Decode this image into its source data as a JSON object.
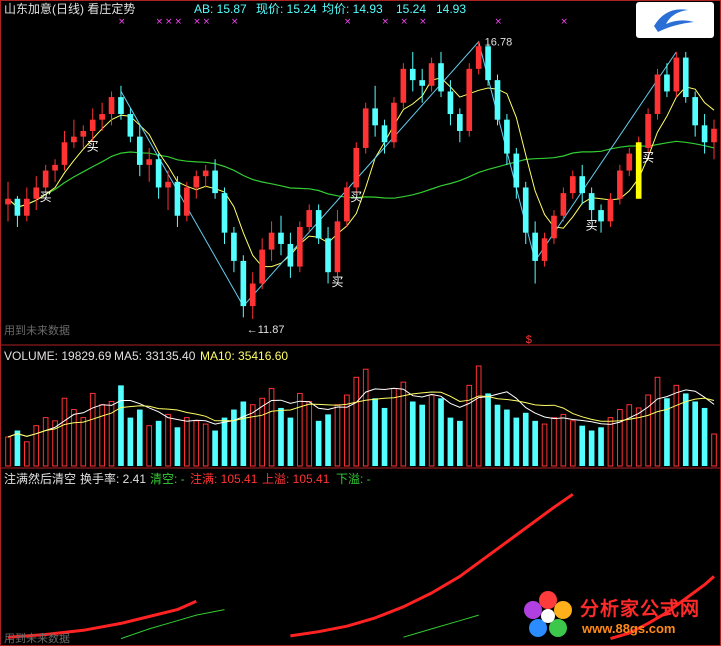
{
  "header": {
    "title": "山东加意(日线)",
    "indicator": "看庄定势",
    "ab_label": "AB: 15.87",
    "price_label": "现价: 15.24",
    "avg_label": "均价: 14.93",
    "extra_1": "15.24",
    "extra_2": "14.93"
  },
  "volume_header": {
    "volume": "VOLUME: 19829.69",
    "ma5": "MA5: 33135.40",
    "ma10": "MA10: 35416.60"
  },
  "indicator_header": {
    "name": "注满然后清空",
    "turnover": "换手率: 2.41",
    "clear": "清空: -",
    "full": "注满: 105.41",
    "overflow_up": "上溢: 105.41",
    "overflow_down": "下溢: -"
  },
  "watermark": "用到未来数据",
  "logo": {
    "name": "分析家公式网",
    "url": "www.88gs.com"
  },
  "colors": {
    "up": "#ff3333",
    "down": "#54ffff",
    "ma_short": "#ffffff",
    "ma_mid": "#ffff66",
    "ma_long": "#33cc33",
    "trend": "#66ccee",
    "marker": "#ff44ff",
    "buy": "#ffffff",
    "highlight": "#ffff00",
    "ind_red": "#ff2222",
    "ind_green": "#33cc33"
  },
  "chart_data": {
    "type": "candlestick",
    "annotations": {
      "high": "16.78",
      "low": "←11.87",
      "dollar": "$",
      "buy": "买"
    },
    "price_range": [
      11.5,
      17.2
    ],
    "candles": [
      [
        13.9,
        14.3,
        13.6,
        14.0
      ],
      [
        14.0,
        14.05,
        13.5,
        13.7
      ],
      [
        13.7,
        14.2,
        13.6,
        14.0
      ],
      [
        14.0,
        14.4,
        13.8,
        14.2
      ],
      [
        14.2,
        14.6,
        14.1,
        14.5
      ],
      [
        14.5,
        14.7,
        14.3,
        14.6
      ],
      [
        14.6,
        15.2,
        14.5,
        15.0
      ],
      [
        15.0,
        15.4,
        14.9,
        15.1
      ],
      [
        15.1,
        15.3,
        14.9,
        15.2
      ],
      [
        15.2,
        15.6,
        15.0,
        15.4
      ],
      [
        15.4,
        15.7,
        15.2,
        15.5
      ],
      [
        15.5,
        15.9,
        15.3,
        15.8
      ],
      [
        15.8,
        16.0,
        15.4,
        15.5
      ],
      [
        15.5,
        15.6,
        15.0,
        15.1
      ],
      [
        15.1,
        15.3,
        14.4,
        14.6
      ],
      [
        14.6,
        14.9,
        14.3,
        14.7
      ],
      [
        14.7,
        14.8,
        14.0,
        14.2
      ],
      [
        14.2,
        14.5,
        13.8,
        14.3
      ],
      [
        14.3,
        14.4,
        13.5,
        13.7
      ],
      [
        13.7,
        14.3,
        13.6,
        14.2
      ],
      [
        14.2,
        14.5,
        14.0,
        14.4
      ],
      [
        14.4,
        14.6,
        14.2,
        14.5
      ],
      [
        14.5,
        14.7,
        14.0,
        14.1
      ],
      [
        14.1,
        14.2,
        13.2,
        13.4
      ],
      [
        13.4,
        13.5,
        12.7,
        12.9
      ],
      [
        12.9,
        13.0,
        11.9,
        12.1
      ],
      [
        12.1,
        12.7,
        11.87,
        12.5
      ],
      [
        12.5,
        13.3,
        12.4,
        13.1
      ],
      [
        13.1,
        13.6,
        12.9,
        13.4
      ],
      [
        13.4,
        13.7,
        13.0,
        13.2
      ],
      [
        13.2,
        13.4,
        12.6,
        12.8
      ],
      [
        12.8,
        13.6,
        12.7,
        13.5
      ],
      [
        13.5,
        13.9,
        13.4,
        13.8
      ],
      [
        13.8,
        13.9,
        13.2,
        13.3
      ],
      [
        13.3,
        13.5,
        12.5,
        12.7
      ],
      [
        12.7,
        13.8,
        12.6,
        13.6
      ],
      [
        13.6,
        14.3,
        13.5,
        14.2
      ],
      [
        14.2,
        15.0,
        14.1,
        14.9
      ],
      [
        14.9,
        15.7,
        14.8,
        15.6
      ],
      [
        15.6,
        16.0,
        15.1,
        15.3
      ],
      [
        15.3,
        15.4,
        14.8,
        15.0
      ],
      [
        15.0,
        15.8,
        14.9,
        15.7
      ],
      [
        15.7,
        16.4,
        15.6,
        16.3
      ],
      [
        16.3,
        16.6,
        15.9,
        16.1
      ],
      [
        16.1,
        16.3,
        15.7,
        16.0
      ],
      [
        16.0,
        16.5,
        15.9,
        16.4
      ],
      [
        16.4,
        16.6,
        15.8,
        15.9
      ],
      [
        15.9,
        16.1,
        15.3,
        15.5
      ],
      [
        15.5,
        15.6,
        15.0,
        15.2
      ],
      [
        15.2,
        16.4,
        15.1,
        16.3
      ],
      [
        16.3,
        16.78,
        16.2,
        16.7
      ],
      [
        16.7,
        16.75,
        16.0,
        16.1
      ],
      [
        16.1,
        16.2,
        15.3,
        15.4
      ],
      [
        15.4,
        15.5,
        14.6,
        14.8
      ],
      [
        14.8,
        14.9,
        14.0,
        14.2
      ],
      [
        14.2,
        14.3,
        13.2,
        13.4
      ],
      [
        13.4,
        13.6,
        12.5,
        12.9
      ],
      [
        12.9,
        13.4,
        12.8,
        13.3
      ],
      [
        13.3,
        13.8,
        13.2,
        13.7
      ],
      [
        13.7,
        14.2,
        13.6,
        14.1
      ],
      [
        14.1,
        14.5,
        14.0,
        14.4
      ],
      [
        14.4,
        14.6,
        13.9,
        14.1
      ],
      [
        14.1,
        14.2,
        13.6,
        13.8
      ],
      [
        13.8,
        13.9,
        13.4,
        13.6
      ],
      [
        13.6,
        14.1,
        13.5,
        14.0
      ],
      [
        14.0,
        14.6,
        13.9,
        14.5
      ],
      [
        14.5,
        14.9,
        14.4,
        14.8
      ],
      [
        14.8,
        15.1,
        14.6,
        14.9
      ],
      [
        14.9,
        15.6,
        14.8,
        15.5
      ],
      [
        15.5,
        16.3,
        15.4,
        16.2
      ],
      [
        16.2,
        16.4,
        15.8,
        15.9
      ],
      [
        15.9,
        16.6,
        15.8,
        16.5
      ],
      [
        16.5,
        16.6,
        15.7,
        15.8
      ],
      [
        15.8,
        15.9,
        15.1,
        15.3
      ],
      [
        15.3,
        15.5,
        14.8,
        15.0
      ],
      [
        15.0,
        15.4,
        14.7,
        15.24
      ]
    ],
    "volume_range": [
      0,
      62000
    ],
    "volumes": [
      18000,
      22000,
      15000,
      25000,
      30000,
      28000,
      42000,
      35000,
      30000,
      45000,
      38000,
      40000,
      50000,
      30000,
      35000,
      25000,
      28000,
      32000,
      24000,
      30000,
      28000,
      26000,
      22000,
      30000,
      35000,
      40000,
      38000,
      42000,
      48000,
      36000,
      30000,
      45000,
      40000,
      28000,
      32000,
      38000,
      44000,
      55000,
      60000,
      42000,
      36000,
      48000,
      52000,
      40000,
      38000,
      44000,
      42000,
      30000,
      28000,
      50000,
      62000,
      45000,
      38000,
      35000,
      30000,
      33000,
      28000,
      26000,
      30000,
      32000,
      28000,
      25000,
      22000,
      24000,
      30000,
      35000,
      38000,
      36000,
      44000,
      55000,
      42000,
      50000,
      45000,
      40000,
      36000,
      19830
    ],
    "indicator_range": [
      0,
      110
    ],
    "indicator_red_segments": [
      [
        [
          0,
          2
        ],
        [
          4,
          4
        ],
        [
          8,
          7
        ],
        [
          12,
          12
        ],
        [
          15,
          17
        ],
        [
          18,
          22
        ],
        [
          20,
          28
        ]
      ],
      [
        [
          30,
          3
        ],
        [
          33,
          6
        ],
        [
          36,
          10
        ],
        [
          39,
          16
        ],
        [
          42,
          24
        ],
        [
          45,
          34
        ],
        [
          48,
          46
        ],
        [
          50,
          56
        ],
        [
          52,
          66
        ],
        [
          54,
          76
        ],
        [
          56,
          86
        ],
        [
          58,
          96
        ],
        [
          60,
          105.41
        ]
      ],
      [
        [
          64,
          1
        ],
        [
          66,
          5
        ],
        [
          68,
          12
        ],
        [
          70,
          20
        ],
        [
          72,
          30
        ],
        [
          74,
          40
        ],
        [
          75,
          46
        ]
      ]
    ],
    "indicator_green_segments": [
      [
        [
          12,
          1
        ],
        [
          15,
          8
        ],
        [
          18,
          14
        ],
        [
          20,
          18
        ],
        [
          23,
          22
        ]
      ],
      [
        [
          42,
          2
        ],
        [
          45,
          8
        ],
        [
          48,
          14
        ],
        [
          50,
          18
        ]
      ]
    ]
  }
}
